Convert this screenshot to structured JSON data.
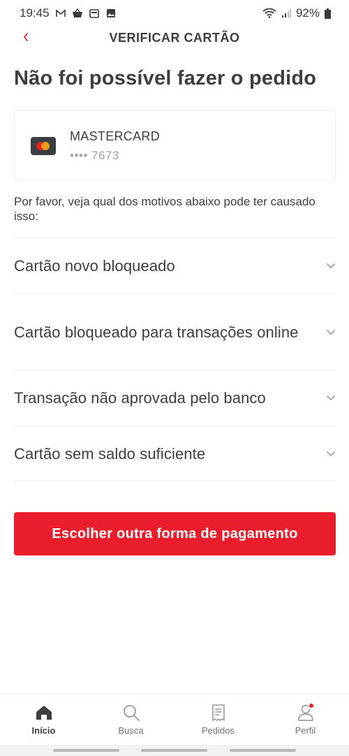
{
  "status_bar": {
    "time": "19:45",
    "battery": "92%",
    "icons": [
      "gmail-icon",
      "basket-icon",
      "calendar-icon",
      "image-icon"
    ],
    "right_icons": [
      "wifi-icon",
      "signal-icon",
      "battery-icon"
    ]
  },
  "header": {
    "back_icon": "chevron-left-icon",
    "title": "VERIFICAR CARTÃO"
  },
  "error": {
    "title": "Não foi possível fazer o pedido"
  },
  "card": {
    "brand": "MASTERCARD",
    "number": "•••• 7673",
    "logo_icon": "mastercard-logo"
  },
  "intro": {
    "text": "Por favor, veja qual dos motivos abaixo pode ter causado isso:"
  },
  "reasons": [
    {
      "label": "Cartão novo bloqueado"
    },
    {
      "label": "Cartão bloqueado para transações online"
    },
    {
      "label": "Transação não aprovada pelo banco"
    },
    {
      "label": "Cartão sem saldo suficiente"
    }
  ],
  "cta": {
    "label": "Escolher outra forma de pagamento"
  },
  "bottom_nav": {
    "items": [
      {
        "label": "Início",
        "icon": "home-icon",
        "active": true
      },
      {
        "label": "Busca",
        "icon": "search-icon",
        "active": false
      },
      {
        "label": "Pedidos",
        "icon": "receipt-icon",
        "active": false
      },
      {
        "label": "Perfil",
        "icon": "profile-icon",
        "active": false,
        "badge": true
      }
    ]
  },
  "colors": {
    "accent": "#ea1d2c",
    "text": "#3e3e3e",
    "muted": "#a6a29f"
  }
}
